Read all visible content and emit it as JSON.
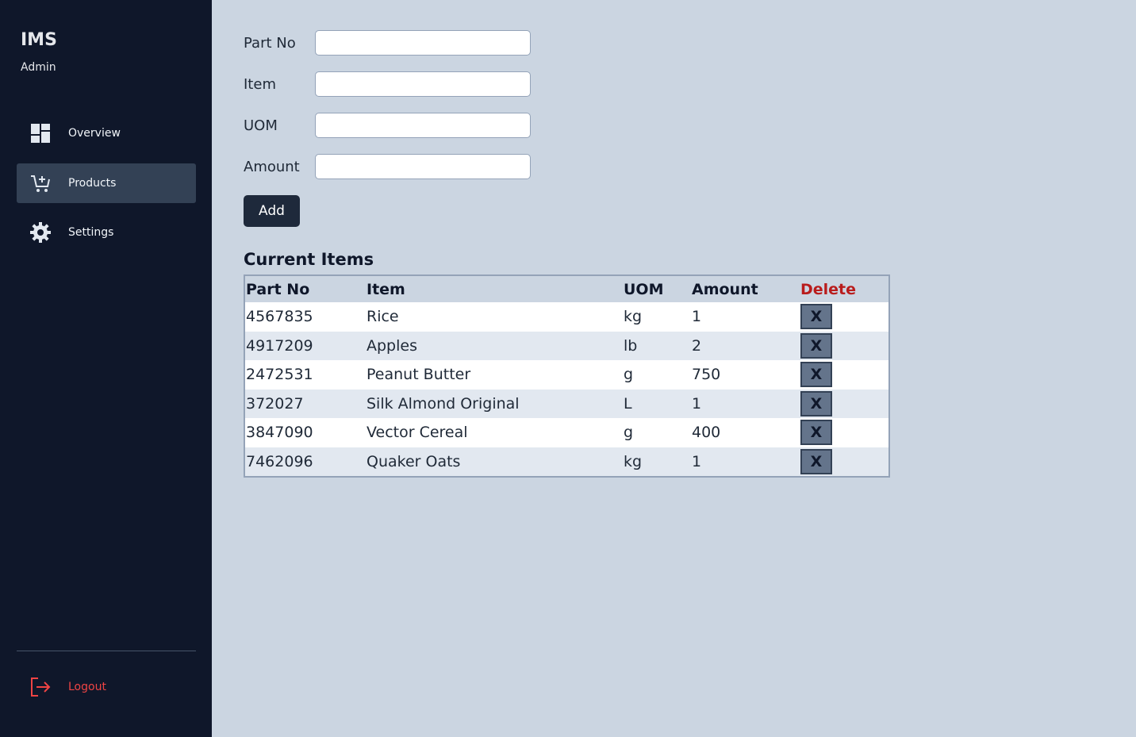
{
  "sidebar": {
    "brand": "IMS",
    "role": "Admin",
    "nav": [
      {
        "label": "Overview",
        "icon": "dashboard-icon"
      },
      {
        "label": "Products",
        "icon": "cart-add-icon",
        "active": true
      },
      {
        "label": "Settings",
        "icon": "gear-icon"
      }
    ],
    "logout": "Logout"
  },
  "form": {
    "part_no_label": "Part No",
    "item_label": "Item",
    "uom_label": "UOM",
    "amount_label": "Amount",
    "part_no_value": "",
    "item_value": "",
    "uom_value": "",
    "amount_value": "",
    "add_label": "Add"
  },
  "table": {
    "title": "Current Items",
    "headers": [
      "Part No",
      "Item",
      "UOM",
      "Amount",
      "Delete"
    ],
    "delete_label": "X",
    "rows": [
      [
        "4567835",
        "Rice",
        "kg",
        "1"
      ],
      [
        "4917209",
        "Apples",
        "lb",
        "2"
      ],
      [
        "2472531",
        "Peanut Butter",
        "g",
        "750"
      ],
      [
        "372027",
        "Silk Almond Original",
        "L",
        "1"
      ],
      [
        "3847090",
        "Vector Cereal",
        "g",
        "400"
      ],
      [
        "7462096",
        "Quaker Oats",
        "kg",
        "1"
      ]
    ]
  },
  "colors": {
    "sidebar_bg": "#0f172a",
    "active_bg": "#334155",
    "main_bg": "#cbd5e1",
    "delete_header": "#b91c1c",
    "logout": "#ef4444"
  }
}
